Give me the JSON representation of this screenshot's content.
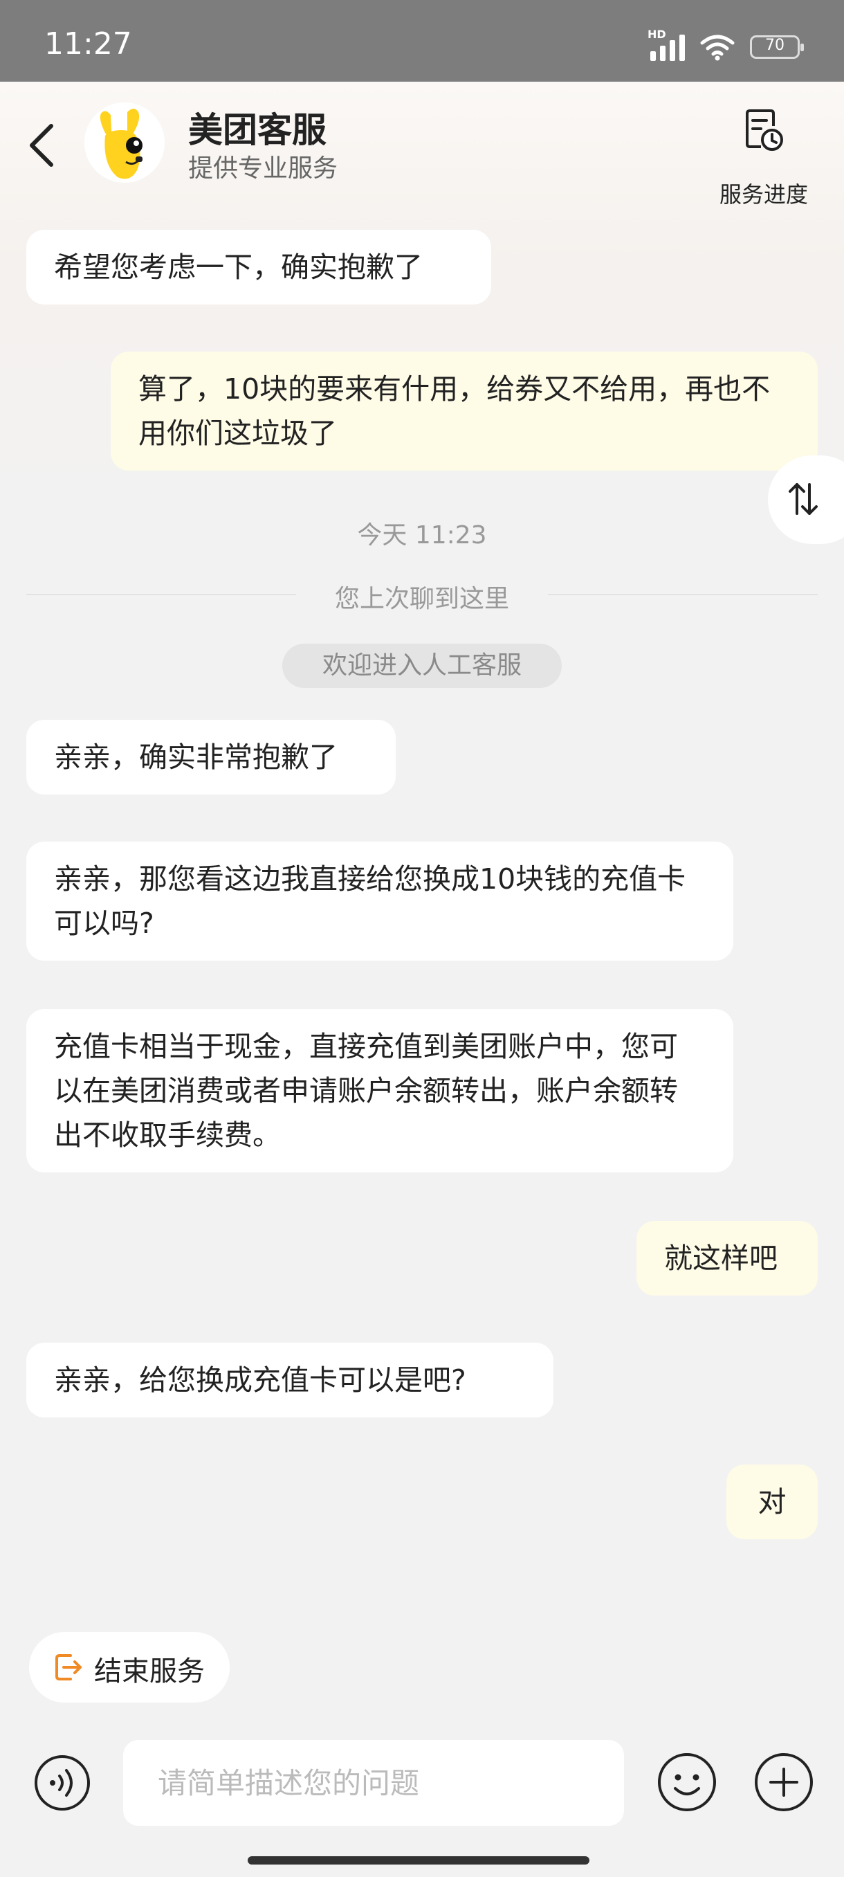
{
  "status_bar": {
    "time": "11:27",
    "network": "HD",
    "battery": "70"
  },
  "header": {
    "title": "美团客服",
    "subtitle": "提供专业服务",
    "progress_label": "服务进度"
  },
  "messages": [
    {
      "from": "agent",
      "text": "希望您考虑一下，确实抱歉了"
    },
    {
      "from": "user",
      "text": "算了，10块的要来有什用，给券又不给用，再也不用你们这垃圾了"
    },
    {
      "from": "agent",
      "text": "亲亲，确实非常抱歉了"
    },
    {
      "from": "agent",
      "text": "亲亲，那您看这边我直接给您换成10块钱的充值卡可以吗?"
    },
    {
      "from": "agent",
      "text": "充值卡相当于现金，直接充值到美团账户中，您可以在美团消费或者申请账户余额转出，账户余额转出不收取手续费。"
    },
    {
      "from": "user",
      "text": "就这样吧"
    },
    {
      "from": "agent",
      "text": "亲亲，给您换成充值卡可以是吧?"
    },
    {
      "from": "user",
      "text": "对"
    }
  ],
  "time_label": "今天 11:23",
  "last_read_label": "您上次聊到这里",
  "welcome_label": "欢迎进入人工客服",
  "end_service_label": "结束服务",
  "input": {
    "placeholder": "请简单描述您的问题",
    "value": ""
  },
  "colors": {
    "accent": "#f08a24",
    "user_bubble": "#fefbe7",
    "agent_bubble": "#ffffff",
    "status_bar": "#7d7d7d"
  },
  "icons": [
    "back-arrow-icon",
    "mascot-avatar",
    "clipboard-clock-icon",
    "swap-arrows-icon",
    "exit-icon",
    "voice-icon",
    "emoji-icon",
    "plus-icon"
  ]
}
